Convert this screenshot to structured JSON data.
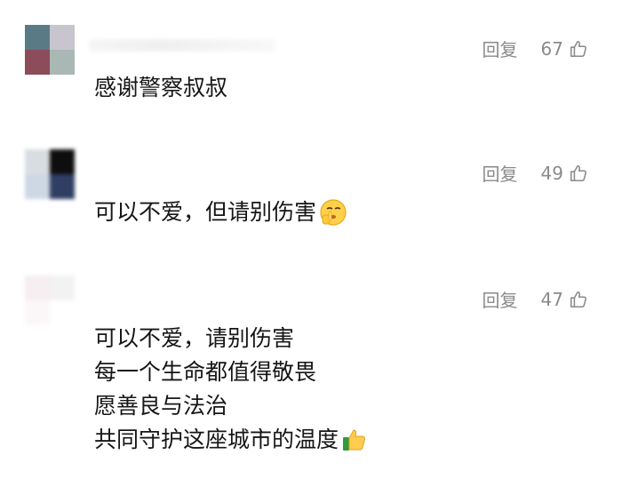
{
  "comments": [
    {
      "avatar_colors": [
        "#5a7b85",
        "#c8c5cf",
        "#8c4c5a",
        "#a9b7b5"
      ],
      "reply_label": "回复",
      "likes": "67",
      "lines": [
        "感谢警察叔叔"
      ]
    },
    {
      "avatar_colors": [
        "#d8dde2",
        "#0e0e0e",
        "#cdd8e4",
        "#2f3e63"
      ],
      "reply_label": "回复",
      "likes": "49",
      "lines": [
        "可以不爱，但请别伤害"
      ],
      "emoji": "shushing-face"
    },
    {
      "avatar_colors": [
        "#f6eef0",
        "#f2f2f2",
        "#fbf7f8",
        "#ffffff"
      ],
      "reply_label": "回复",
      "likes": "47",
      "lines": [
        "可以不爱，请别伤害",
        "每一个生命都值得敬畏",
        "愿善良与法治",
        "共同守护这座城市的温度"
      ],
      "emoji": "thumbs-up"
    }
  ]
}
